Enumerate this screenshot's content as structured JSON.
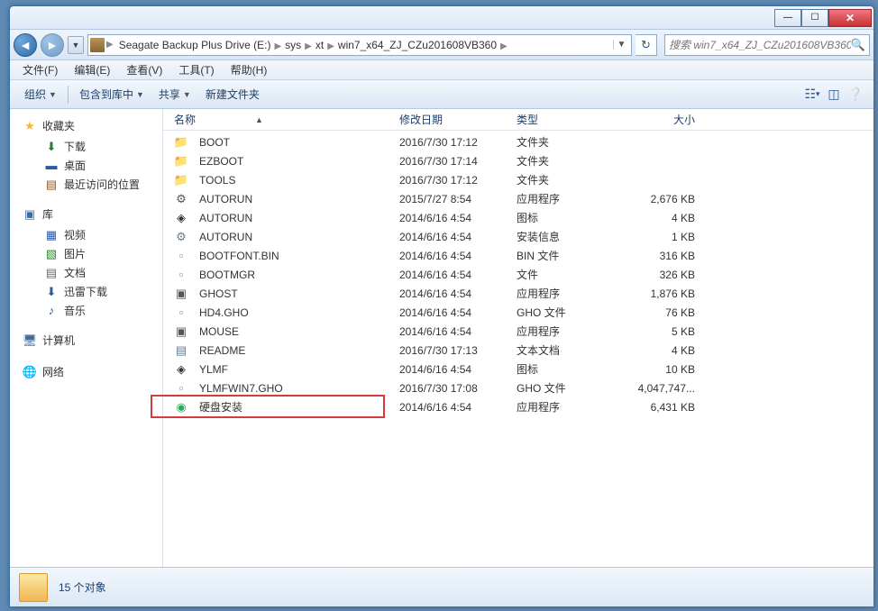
{
  "breadcrumbs": [
    "Seagate Backup Plus Drive (E:)",
    "sys",
    "xt",
    "win7_x64_ZJ_CZu201608VB360"
  ],
  "search_placeholder": "搜索 win7_x64_ZJ_CZu201608VB360",
  "menu": {
    "file": "文件(F)",
    "edit": "编辑(E)",
    "view": "查看(V)",
    "tools": "工具(T)",
    "help": "帮助(H)"
  },
  "toolbar": {
    "organize": "组织",
    "include": "包含到库中",
    "share": "共享",
    "newfolder": "新建文件夹"
  },
  "sidebar": {
    "favorites": {
      "label": "收藏夹",
      "items": [
        {
          "label": "下载",
          "icon": "ico-dl",
          "glyph": "⬇"
        },
        {
          "label": "桌面",
          "icon": "ico-desk",
          "glyph": "▬"
        },
        {
          "label": "最近访问的位置",
          "icon": "ico-recent",
          "glyph": "▤"
        }
      ]
    },
    "libraries": {
      "label": "库",
      "items": [
        {
          "label": "视频",
          "icon": "ico-vid",
          "glyph": "▦"
        },
        {
          "label": "图片",
          "icon": "ico-pic",
          "glyph": "▧"
        },
        {
          "label": "文档",
          "icon": "ico-doc",
          "glyph": "▤"
        },
        {
          "label": "迅雷下载",
          "icon": "ico-thunder",
          "glyph": "⬇"
        },
        {
          "label": "音乐",
          "icon": "ico-music",
          "glyph": "♪"
        }
      ]
    },
    "computer": {
      "label": "计算机"
    },
    "network": {
      "label": "网络"
    }
  },
  "columns": {
    "name": "名称",
    "date": "修改日期",
    "type": "类型",
    "size": "大小"
  },
  "files": [
    {
      "name": "BOOT",
      "date": "2016/7/30 17:12",
      "type": "文件夹",
      "size": "",
      "icon": "ico-folder",
      "glyph": "📁"
    },
    {
      "name": "EZBOOT",
      "date": "2016/7/30 17:14",
      "type": "文件夹",
      "size": "",
      "icon": "ico-folder",
      "glyph": "📁"
    },
    {
      "name": "TOOLS",
      "date": "2016/7/30 17:12",
      "type": "文件夹",
      "size": "",
      "icon": "ico-folder",
      "glyph": "📁"
    },
    {
      "name": "AUTORUN",
      "date": "2015/7/27 8:54",
      "type": "应用程序",
      "size": "2,676 KB",
      "icon": "ico-exe",
      "glyph": "⚙"
    },
    {
      "name": "AUTORUN",
      "date": "2014/6/16 4:54",
      "type": "图标",
      "size": "4 KB",
      "icon": "ico-ico",
      "glyph": "◈"
    },
    {
      "name": "AUTORUN",
      "date": "2014/6/16 4:54",
      "type": "安装信息",
      "size": "1 KB",
      "icon": "ico-inf",
      "glyph": "⚙"
    },
    {
      "name": "BOOTFONT.BIN",
      "date": "2014/6/16 4:54",
      "type": "BIN 文件",
      "size": "316 KB",
      "icon": "ico-bin",
      "glyph": "▫"
    },
    {
      "name": "BOOTMGR",
      "date": "2014/6/16 4:54",
      "type": "文件",
      "size": "326 KB",
      "icon": "ico-bin",
      "glyph": "▫"
    },
    {
      "name": "GHOST",
      "date": "2014/6/16 4:54",
      "type": "应用程序",
      "size": "1,876 KB",
      "icon": "ico-exe",
      "glyph": "▣"
    },
    {
      "name": "HD4.GHO",
      "date": "2014/6/16 4:54",
      "type": "GHO 文件",
      "size": "76 KB",
      "icon": "ico-gho",
      "glyph": "▫"
    },
    {
      "name": "MOUSE",
      "date": "2014/6/16 4:54",
      "type": "应用程序",
      "size": "5 KB",
      "icon": "ico-exe",
      "glyph": "▣"
    },
    {
      "name": "README",
      "date": "2016/7/30 17:13",
      "type": "文本文档",
      "size": "4 KB",
      "icon": "ico-txt",
      "glyph": "▤"
    },
    {
      "name": "YLMF",
      "date": "2014/6/16 4:54",
      "type": "图标",
      "size": "10 KB",
      "icon": "ico-ico",
      "glyph": "◈"
    },
    {
      "name": "YLMFWIN7.GHO",
      "date": "2016/7/30 17:08",
      "type": "GHO 文件",
      "size": "4,047,747...",
      "icon": "ico-gho",
      "glyph": "▫"
    },
    {
      "name": "硬盘安装",
      "date": "2014/6/16 4:54",
      "type": "应用程序",
      "size": "6,431 KB",
      "icon": "ico-green",
      "glyph": "◉"
    }
  ],
  "footer": {
    "count": "15 个对象"
  },
  "highlight_index": 14
}
